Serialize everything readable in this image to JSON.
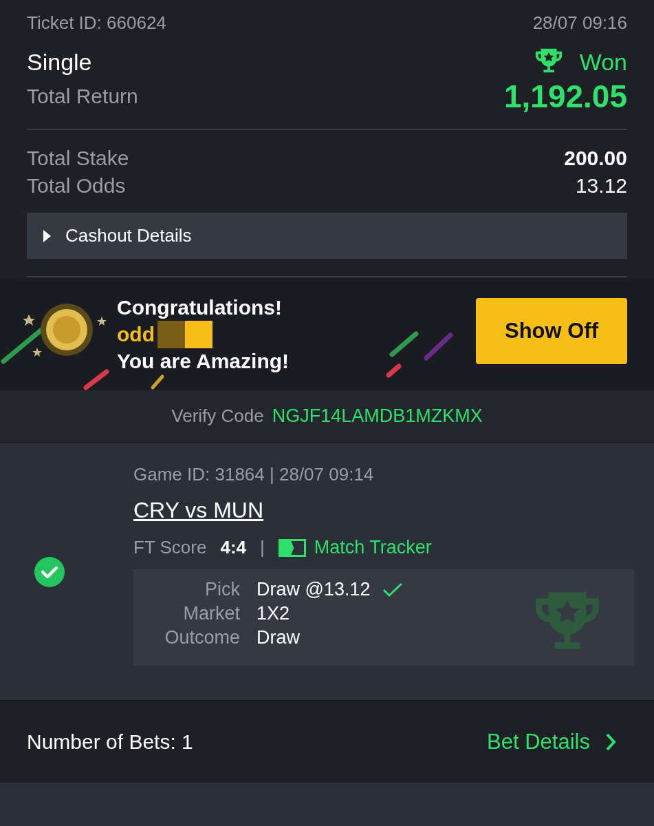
{
  "ticket": {
    "id_label": "Ticket ID: 660624",
    "time": "28/07 09:16",
    "bet_type": "Single",
    "status": "Won",
    "won": true,
    "return_label": "Total Return",
    "return_value": "1,192.05"
  },
  "summary": [
    {
      "label": "Total Stake",
      "value": "200.00",
      "bold": true
    },
    {
      "label": "Total Odds",
      "value": "13.12",
      "bold": false
    }
  ],
  "cashout": {
    "label": "Cashout Details",
    "expanded": false
  },
  "banner": {
    "title": "Congratulations!",
    "user": "odd",
    "message": "You are Amazing!",
    "button": "Show Off"
  },
  "verify": {
    "label": "Verify Code",
    "code": "NGJF14LAMDB1MZKMX"
  },
  "selection": {
    "won": true,
    "game_line": "Game ID: 31864 | 28/07 09:14",
    "match": "CRY vs MUN",
    "score_label": "FT Score",
    "score": "4:4",
    "separator": "|",
    "tracker": "Match Tracker",
    "details": [
      {
        "label": "Pick",
        "value": "Draw @13.12",
        "correct": true
      },
      {
        "label": "Market",
        "value": "1X2",
        "correct": false
      },
      {
        "label": "Outcome",
        "value": "Draw",
        "correct": false
      }
    ]
  },
  "footer": {
    "bets": "Number of Bets: 1",
    "link": "Bet Details"
  }
}
